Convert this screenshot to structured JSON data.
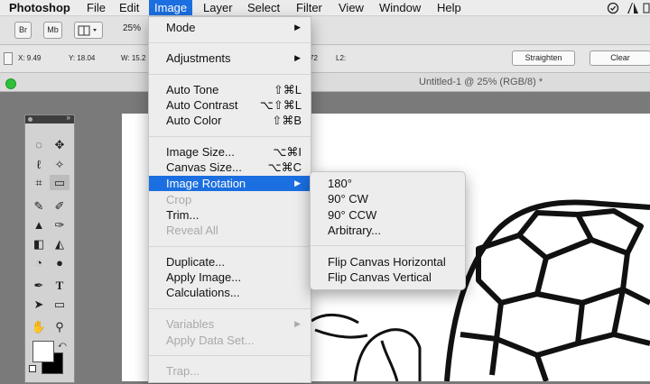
{
  "menubar": {
    "app": "Photoshop",
    "items": [
      "File",
      "Edit",
      "Image",
      "Layer",
      "Select",
      "Filter",
      "View",
      "Window",
      "Help"
    ]
  },
  "options_bar": {
    "br": "Br",
    "mb": "Mb",
    "zoom": "25%"
  },
  "control_bar": {
    "x": "X: 9.49",
    "y": "Y: 18.04",
    "w": "W: 15.2",
    "angle": "72",
    "l2": "L2:",
    "straighten": "Straighten",
    "clear": "Clear"
  },
  "document": {
    "title": "Untitled-1 @ 25% (RGB/8) *"
  },
  "image_menu": {
    "mode": "Mode",
    "adjustments": "Adjustments",
    "auto_tone": "Auto Tone",
    "auto_tone_sc": "⇧⌘L",
    "auto_contrast": "Auto Contrast",
    "auto_contrast_sc": "⌥⇧⌘L",
    "auto_color": "Auto Color",
    "auto_color_sc": "⇧⌘B",
    "image_size": "Image Size...",
    "image_size_sc": "⌥⌘I",
    "canvas_size": "Canvas Size...",
    "canvas_size_sc": "⌥⌘C",
    "image_rotation": "Image Rotation",
    "crop": "Crop",
    "trim": "Trim...",
    "reveal_all": "Reveal All",
    "duplicate": "Duplicate...",
    "apply_image": "Apply Image...",
    "calculations": "Calculations...",
    "variables": "Variables",
    "apply_data_set": "Apply Data Set...",
    "trap": "Trap..."
  },
  "rotation_menu": {
    "r180": "180°",
    "r90cw": "90° CW",
    "r90ccw": "90° CCW",
    "arbitrary": "Arbitrary...",
    "flip_h": "Flip Canvas Horizontal",
    "flip_v": "Flip Canvas Vertical"
  },
  "colors": {
    "accent": "#1b6fe0",
    "menu_bg": "#ededed"
  }
}
